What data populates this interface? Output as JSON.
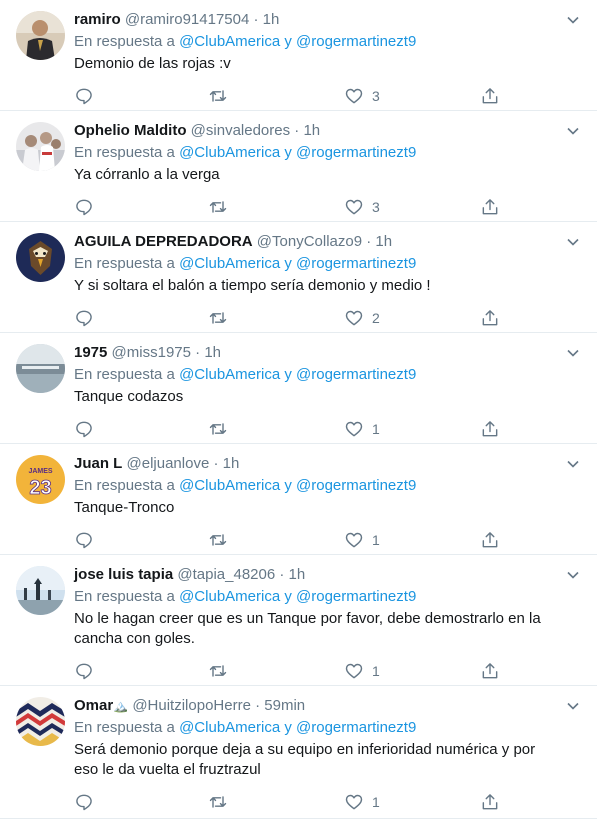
{
  "tweets": [
    {
      "name": "ramiro",
      "handle": "@ramiro91417504",
      "time": "1h",
      "reply_prefix": "En respuesta a",
      "mention1": "@ClubAmerica",
      "conj": "y",
      "mention2": "@rogermartinezt9",
      "text": "Demonio de las rojas :v",
      "likes": "3"
    },
    {
      "name": "Ophelio Maldito",
      "handle": "@sinvaledores",
      "time": "1h",
      "reply_prefix": "En respuesta a",
      "mention1": "@ClubAmerica",
      "conj": "y",
      "mention2": "@rogermartinezt9",
      "text": "Ya córranlo a la verga",
      "likes": "3"
    },
    {
      "name": "AGUILA DEPREDADORA",
      "handle": "@TonyCollazo9",
      "time": "1h",
      "reply_prefix": "En respuesta a",
      "mention1": "@ClubAmerica",
      "conj": "y",
      "mention2": "@rogermartinezt9",
      "text": "Y si soltara el balón a tiempo sería demonio y medio !",
      "likes": "2"
    },
    {
      "name": "1975",
      "handle": "@miss1975",
      "time": "1h",
      "reply_prefix": "En respuesta a",
      "mention1": "@ClubAmerica",
      "conj": "y",
      "mention2": "@rogermartinezt9",
      "text": "Tanque codazos",
      "likes": "1"
    },
    {
      "name": "Juan L",
      "handle": "@eljuanlove",
      "time": "1h",
      "reply_prefix": "En respuesta a",
      "mention1": "@ClubAmerica",
      "conj": "y",
      "mention2": "@rogermartinezt9",
      "text": "Tanque-Tronco",
      "likes": "1"
    },
    {
      "name": "jose luis tapia",
      "handle": "@tapia_48206",
      "time": "1h",
      "reply_prefix": "En respuesta a",
      "mention1": "@ClubAmerica",
      "conj": "y",
      "mention2": "@rogermartinezt9",
      "text": "No le hagan creer que es un Tanque por favor,  debe demostrarlo en la cancha con goles.",
      "likes": "1"
    },
    {
      "name": "Omar",
      "name_emoji": "🏔️",
      "handle": "@HuitzilopoHerre",
      "time": "59min",
      "reply_prefix": "En respuesta a",
      "mention1": "@ClubAmerica",
      "conj": "y",
      "mention2": "@rogermartinezt9",
      "text": "Será demonio porque deja a su equipo en inferioridad numérica y por eso le da vuelta el fruztrazul",
      "likes": "1"
    }
  ],
  "avatar_text": {
    "juan": "23",
    "juan_top": "JAMES"
  },
  "colors": {
    "mention": "#1b95e0",
    "secondary": "#657786",
    "divider": "#e6ecf0"
  },
  "icons": [
    "reply-icon",
    "retweet-icon",
    "like-icon",
    "share-icon",
    "chevron-down-icon"
  ]
}
